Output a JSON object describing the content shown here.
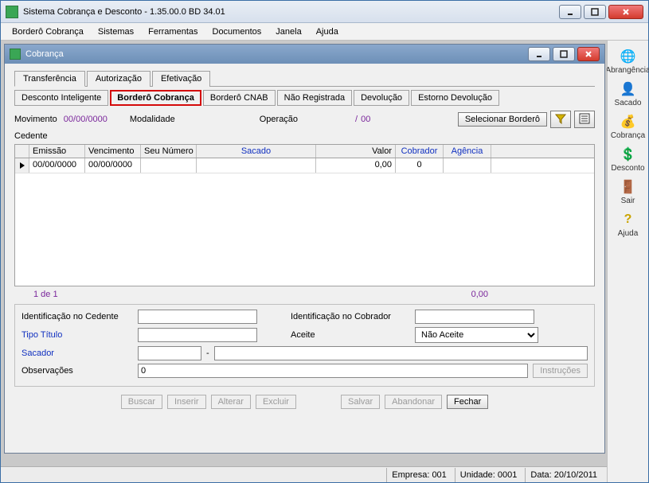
{
  "app": {
    "title": "Sistema Cobrança e Desconto - 1.35.00.0 BD 34.01"
  },
  "menu": {
    "bordero": "Borderô Cobrança",
    "sistemas": "Sistemas",
    "ferramentas": "Ferramentas",
    "documentos": "Documentos",
    "janela": "Janela",
    "ajuda": "Ajuda"
  },
  "sideToolbar": {
    "abrangencia": "Abrangência",
    "sacado": "Sacado",
    "cobranca": "Cobrança",
    "desconto": "Desconto",
    "sair": "Sair",
    "ajuda": "Ajuda"
  },
  "child": {
    "title": "Cobrança"
  },
  "tabs1": {
    "transferencia": "Transferência",
    "autorizacao": "Autorização",
    "efetivacao": "Efetivação"
  },
  "tabs2": {
    "descontoInteligente": "Desconto Inteligente",
    "borderoCobranca": "Borderô Cobrança",
    "borderoCnab": "Borderô CNAB",
    "naoRegistrada": "Não Registrada",
    "devolucao": "Devolução",
    "estornoDevolucao": "Estorno Devolução"
  },
  "info": {
    "movimento_label": "Movimento",
    "movimento_val": "00/00/0000",
    "modalidade_label": "Modalidade",
    "modalidade_val": "",
    "operacao_label": "Operação",
    "operacao_sep": "/",
    "operacao_val": "00",
    "cedente_label": "Cedente",
    "cedente_val": "",
    "selecionar_btn": "Selecionar Borderô"
  },
  "grid": {
    "headers": {
      "emissao": "Emissão",
      "vencimento": "Vencimento",
      "seuNumero": "Seu Número",
      "sacado": "Sacado",
      "valor": "Valor",
      "cobrador": "Cobrador",
      "agencia": "Agência"
    },
    "rows": [
      {
        "emissao": "00/00/0000",
        "vencimento": "00/00/0000",
        "seuNumero": "",
        "sacado": "",
        "valor": "0,00",
        "cobrador": "0",
        "agencia": ""
      }
    ]
  },
  "totals": {
    "count": "1 de 1",
    "sum": "0,00"
  },
  "details": {
    "identCedente_label": "Identificação no Cedente",
    "identCedente_val": "",
    "identCobrador_label": "Identificação no Cobrador",
    "identCobrador_val": "",
    "tipoTitulo_label": "Tipo Título",
    "tipoTitulo_val": "",
    "aceite_label": "Aceite",
    "aceite_val": "Não Aceite",
    "sacador_label": "Sacador",
    "sacador_val_a": "",
    "sacador_sep": "-",
    "sacador_val_b": "",
    "observ_label": "Observações",
    "observ_val": "0",
    "instrucoes_btn": "Instruções"
  },
  "buttons": {
    "buscar": "Buscar",
    "inserir": "Inserir",
    "alterar": "Alterar",
    "excluir": "Excluir",
    "salvar": "Salvar",
    "abandonar": "Abandonar",
    "fechar": "Fechar"
  },
  "status": {
    "empresa_label": "Empresa:",
    "empresa_val": "001",
    "unidade_label": "Unidade:",
    "unidade_val": "0001",
    "data_label": "Data:",
    "data_val": "20/10/2011"
  }
}
